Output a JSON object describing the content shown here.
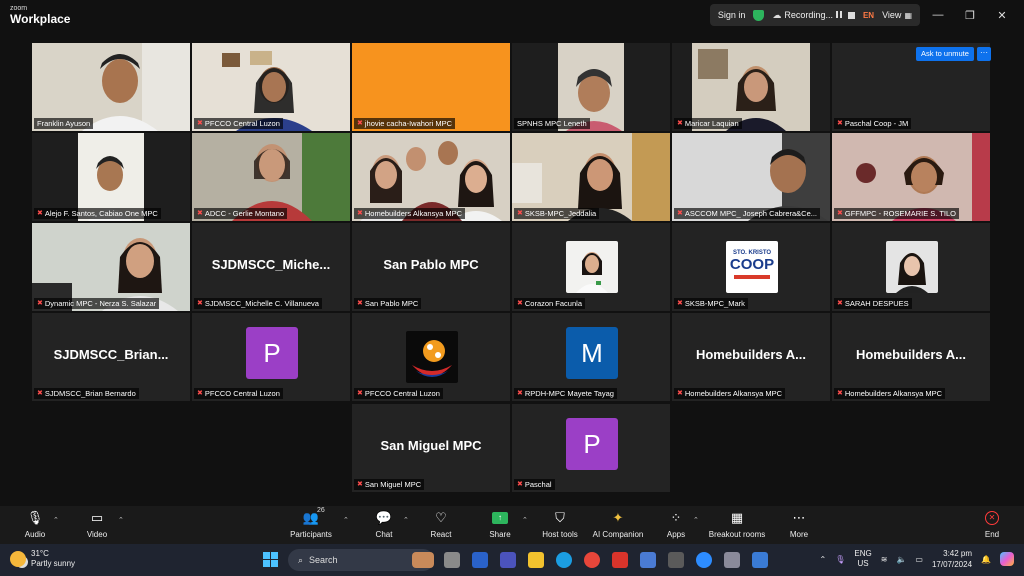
{
  "titlebar": {
    "logo_top": "zoom",
    "logo_bottom": "Workplace",
    "sign_in": "Sign in",
    "recording": "Recording...",
    "lang": "EN",
    "view": "View"
  },
  "grid": {
    "ask_unmute": "Ask to unmute",
    "more": "···",
    "tiles": [
      {
        "name": "Franklin Ayuson"
      },
      {
        "name": "PFCCO Central Luzon"
      },
      {
        "name": "jhovie cacha-Iwahori MPC"
      },
      {
        "name": "SPNHS MPC Leneth"
      },
      {
        "name": "Maricar Laquian"
      },
      {
        "name": "Paschal Coop - JM"
      },
      {
        "name": "Alejo F. Santos, Cabiao One MPC"
      },
      {
        "name": "ADCC - Gerlie Montano"
      },
      {
        "name": "Homebuilders Alkansya MPC"
      },
      {
        "name": "SKSB-MPC_Jeddalia"
      },
      {
        "name": "ASCCOM MPC_ Joseph Cabrera&Ce..."
      },
      {
        "name": "GFFMPC - ROSEMARIE S. TILO"
      },
      {
        "name": "Dynamic MPC - Nerza S. Salazar"
      },
      {
        "name": "SJDMSCC_Michelle C. Villanueva",
        "big": "SJDMSCC_Miche..."
      },
      {
        "name": "San Pablo MPC",
        "big": "San Pablo MPC"
      },
      {
        "name": "Corazon Facunla"
      },
      {
        "name": "SKSB-MPC_Mark",
        "logo_line1": "STO. KRISTO",
        "logo_line2": "COOP"
      },
      {
        "name": "SARAH DESPUES"
      },
      {
        "name": "SJDMSCC_Brian Bernardo",
        "big": "SJDMSCC_Brian..."
      },
      {
        "name": "PFCCO Central Luzon",
        "letter": "P"
      },
      {
        "name": "PFCCO Central Luzon"
      },
      {
        "name": "RPDH-MPC Mayete Tayag",
        "letter": "M"
      },
      {
        "name": "Homebuilders Alkansya MPC",
        "big": "Homebuilders A..."
      },
      {
        "name": "Homebuilders Alkansya MPC",
        "big": "Homebuilders A..."
      },
      {
        "name": "San Miguel MPC",
        "big": "San Miguel MPC"
      },
      {
        "name": "Paschal",
        "letter": "P"
      }
    ]
  },
  "toolbar": {
    "audio": "Audio",
    "video": "Video",
    "participants": "Participants",
    "participants_count": "26",
    "chat": "Chat",
    "react": "React",
    "share": "Share",
    "host_tools": "Host tools",
    "ai_companion": "AI Companion",
    "apps": "Apps",
    "breakout_rooms": "Breakout rooms",
    "more": "More",
    "end": "End"
  },
  "taskbar": {
    "temp": "31°C",
    "weather": "Partly sunny",
    "search": "Search",
    "lang_1": "ENG",
    "lang_2": "US",
    "time": "3:42 pm",
    "date": "17/07/2024"
  },
  "colors": {
    "accent_blue": "#0e72ed",
    "active_green": "#3ad96b",
    "mic_off": "#ff4d4d",
    "purple_avatar": "#9b3fc6",
    "blue_avatar": "#0b5cab",
    "orange_tile": "#f7931e"
  }
}
